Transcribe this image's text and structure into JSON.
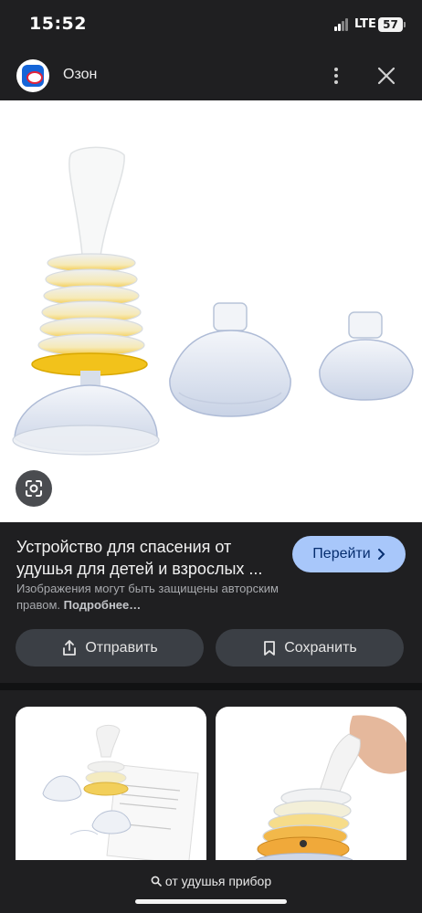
{
  "status_bar": {
    "time": "15:52",
    "network": "LTE",
    "battery": "57"
  },
  "header": {
    "site_name": "Озон",
    "logo_icon": "ozon-logo",
    "more_icon": "more-vert-icon",
    "close_icon": "close-icon"
  },
  "result": {
    "title": "Устройство для спасения от удушья для детей и взрослых ...",
    "go_label": "Перейти",
    "copyright_text": "Изображения могут быть защищены авторским правом.",
    "more_link": "Подробнее…",
    "share_label": "Отправить",
    "save_label": "Сохранить"
  },
  "search": {
    "query": "от удушья прибор"
  },
  "colors": {
    "background": "#1f1f21",
    "accent": "#a8c7fa",
    "button": "#3b3f45"
  }
}
